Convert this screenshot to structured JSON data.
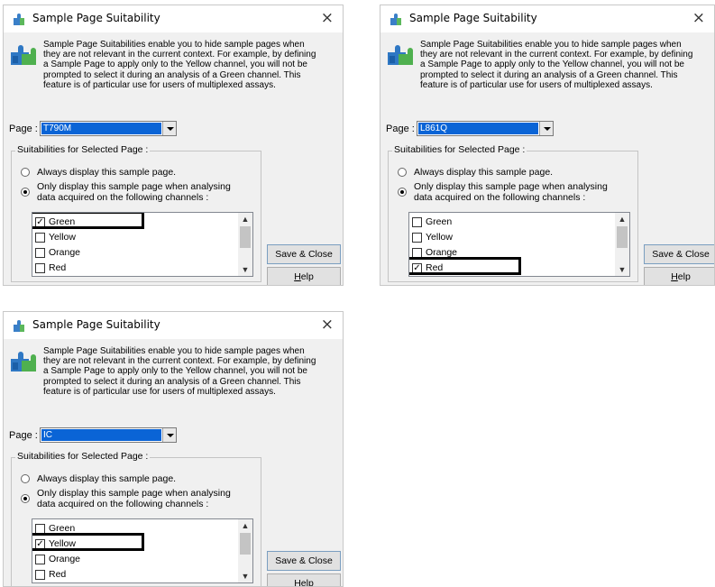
{
  "dialogs": [
    {
      "title": "Sample Page Suitability",
      "close": "×",
      "description": "Sample Page Suitabilities enable you to hide sample pages when they are not relevant in the current context. For example, by defining a Sample Page to apply only to the Yellow channel, you will not be prompted to select it during an analysis of a Green channel. This feature is of particular use for users of multiplexed assays.",
      "page_label": "Page :",
      "page_value": "T790M",
      "group_label": "Suitabilities for Selected Page :",
      "radio_always": "Always display this sample page.",
      "radio_only": "Only display this sample page when analysing\ndata acquired on the following channels :",
      "radio_selected": "only",
      "channels": [
        {
          "label": "Green",
          "checked": true
        },
        {
          "label": "Yellow",
          "checked": false
        },
        {
          "label": "Orange",
          "checked": false
        },
        {
          "label": "Red",
          "checked": false
        }
      ],
      "highlighted_channel": "Green",
      "save_label": "Save & Close",
      "help_label": "Help"
    },
    {
      "title": "Sample Page Suitability",
      "close": "×",
      "description": "Sample Page Suitabilities enable you to hide sample pages when they are not relevant in the current context. For example, by defining a Sample Page to apply only to the Yellow channel, you will not be prompted to select it during an analysis of a Green channel. This feature is of particular use for users of multiplexed assays.",
      "page_label": "Page :",
      "page_value": "L861Q",
      "group_label": "Suitabilities for Selected Page :",
      "radio_always": "Always display this sample page.",
      "radio_only": "Only display this sample page when analysing\ndata acquired on the following channels :",
      "radio_selected": "only",
      "channels": [
        {
          "label": "Green",
          "checked": false
        },
        {
          "label": "Yellow",
          "checked": false
        },
        {
          "label": "Orange",
          "checked": false
        },
        {
          "label": "Red",
          "checked": true
        }
      ],
      "highlighted_channel": "Red",
      "save_label": "Save & Close",
      "help_label": "Help"
    },
    {
      "title": "Sample Page Suitability",
      "close": "×",
      "description": "Sample Page Suitabilities enable you to hide sample pages when they are not relevant in the current context. For example, by defining a Sample Page to apply only to the Yellow channel, you will not be prompted to select it during an analysis of a Green channel. This feature is of particular use for users of multiplexed assays.",
      "page_label": "Page :",
      "page_value": "IC",
      "group_label": "Suitabilities for Selected Page :",
      "radio_always": "Always display this sample page.",
      "radio_only": "Only display this sample page when analysing\ndata acquired on the following channels :",
      "radio_selected": "only",
      "channels": [
        {
          "label": "Green",
          "checked": false
        },
        {
          "label": "Yellow",
          "checked": true
        },
        {
          "label": "Orange",
          "checked": false
        },
        {
          "label": "Red",
          "checked": false
        }
      ],
      "highlighted_channel": "Yellow",
      "save_label": "Save & Close",
      "help_label": "Help"
    }
  ]
}
